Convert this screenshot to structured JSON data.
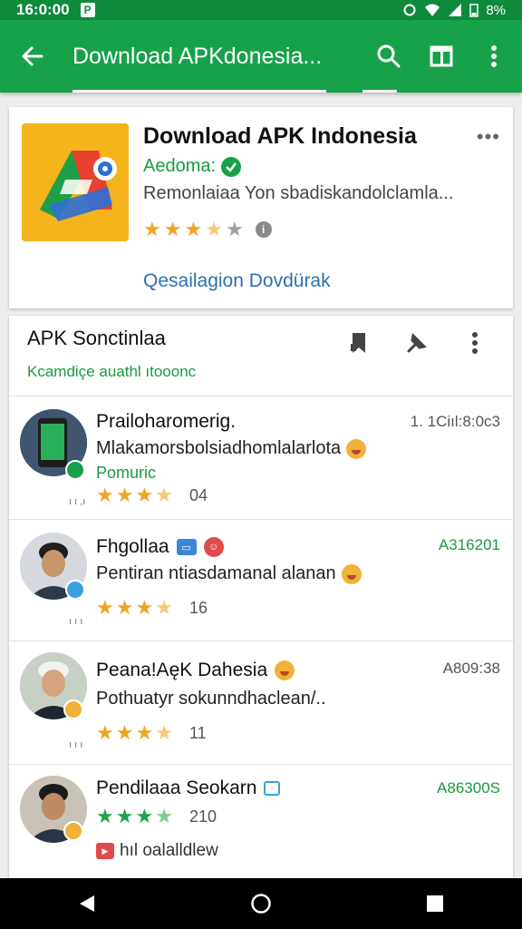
{
  "status_bar": {
    "time": "16:0:00",
    "notification_letter": "P",
    "battery": "8%"
  },
  "app_bar": {
    "title": "Download APKdonesia..."
  },
  "app_card": {
    "name": "Download APK Indonesia",
    "developer": "Aedoma:",
    "description": "Remonlaiaa Yon sbadiskandolclamla...",
    "rating_stars": 3.5,
    "link": "Qesailagion Dovdürak"
  },
  "section": {
    "title": "APK Sonctinlaa",
    "subtitle": "Kcamdiçe auathl ıtooonc"
  },
  "items": [
    {
      "title": "Prailoharomerig.",
      "meta": "1. 1Ciıl:8:0c3",
      "description": "Mlakamorsbolsiadhomlalarlota",
      "tag": "Pomuric",
      "stars": 3.5,
      "count": "04",
      "tiny": "ı ı ,ı"
    },
    {
      "title": "Fhgollaa",
      "meta": "A316201",
      "description": "Pentiran ntiasdamanal alanan",
      "stars": 3.5,
      "count": "16",
      "tiny": "ı ı ı"
    },
    {
      "title": "Peana!AęK Dahesia",
      "meta": "A809:38",
      "description": "Pothuatyr sokunndhaclean/..",
      "stars": 3.5,
      "count": "11",
      "tiny": "ı ı ı"
    },
    {
      "title": "Pendilaaa Seokarn",
      "meta": "A86300S",
      "stars": 3.5,
      "count": "210",
      "footer": "hıl oalalldlew"
    }
  ],
  "colors": {
    "primary": "#17a249",
    "status_bar": "#0f8a3c",
    "link": "#2f6fb0",
    "star": "#f0a424"
  },
  "icons": {
    "back": "arrow-left-icon",
    "search": "search-icon",
    "window": "window-icon",
    "more": "more-vert-icon"
  }
}
